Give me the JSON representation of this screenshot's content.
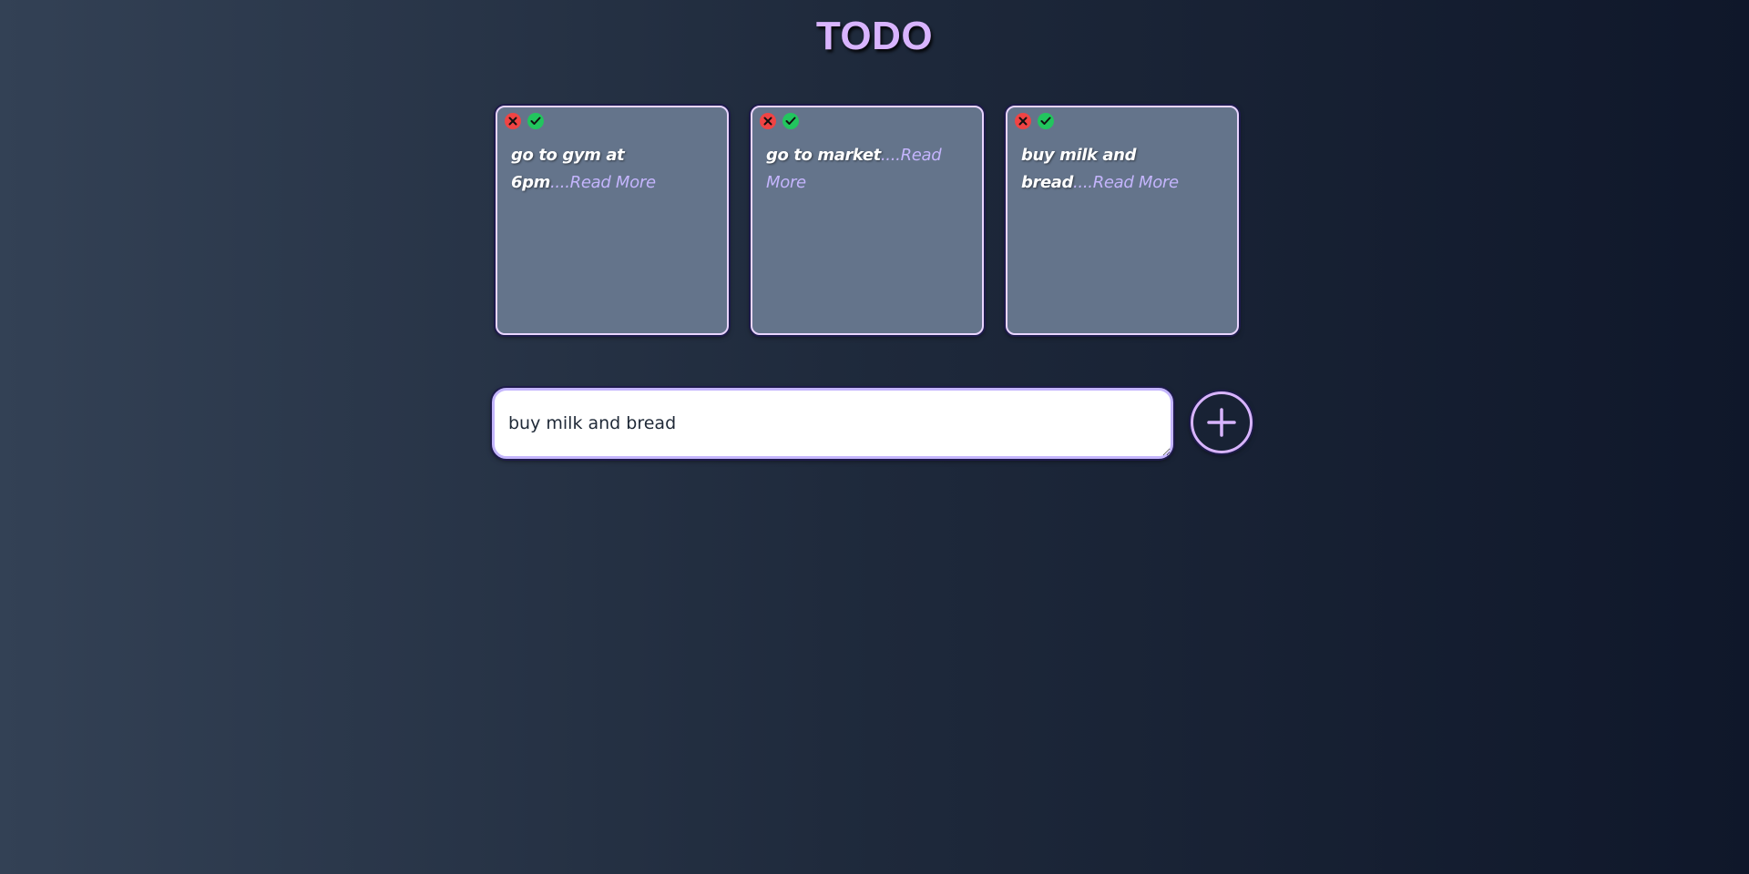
{
  "app": {
    "title": "TODO"
  },
  "colors": {
    "accent": "#d8b4fe",
    "card_background": "#64748b",
    "delete": "#ef4444",
    "done": "#22c55e"
  },
  "todos": [
    {
      "text": "go to gym at 6pm",
      "read_more": "....Read More"
    },
    {
      "text": "go to market",
      "read_more": "....Read More"
    },
    {
      "text": "buy milk and bread",
      "read_more": "....Read More"
    }
  ],
  "card_icons": {
    "delete": "close-icon",
    "done": "check-icon"
  },
  "input": {
    "value": "buy milk and bread"
  },
  "add_button": {
    "icon": "plus-icon"
  }
}
